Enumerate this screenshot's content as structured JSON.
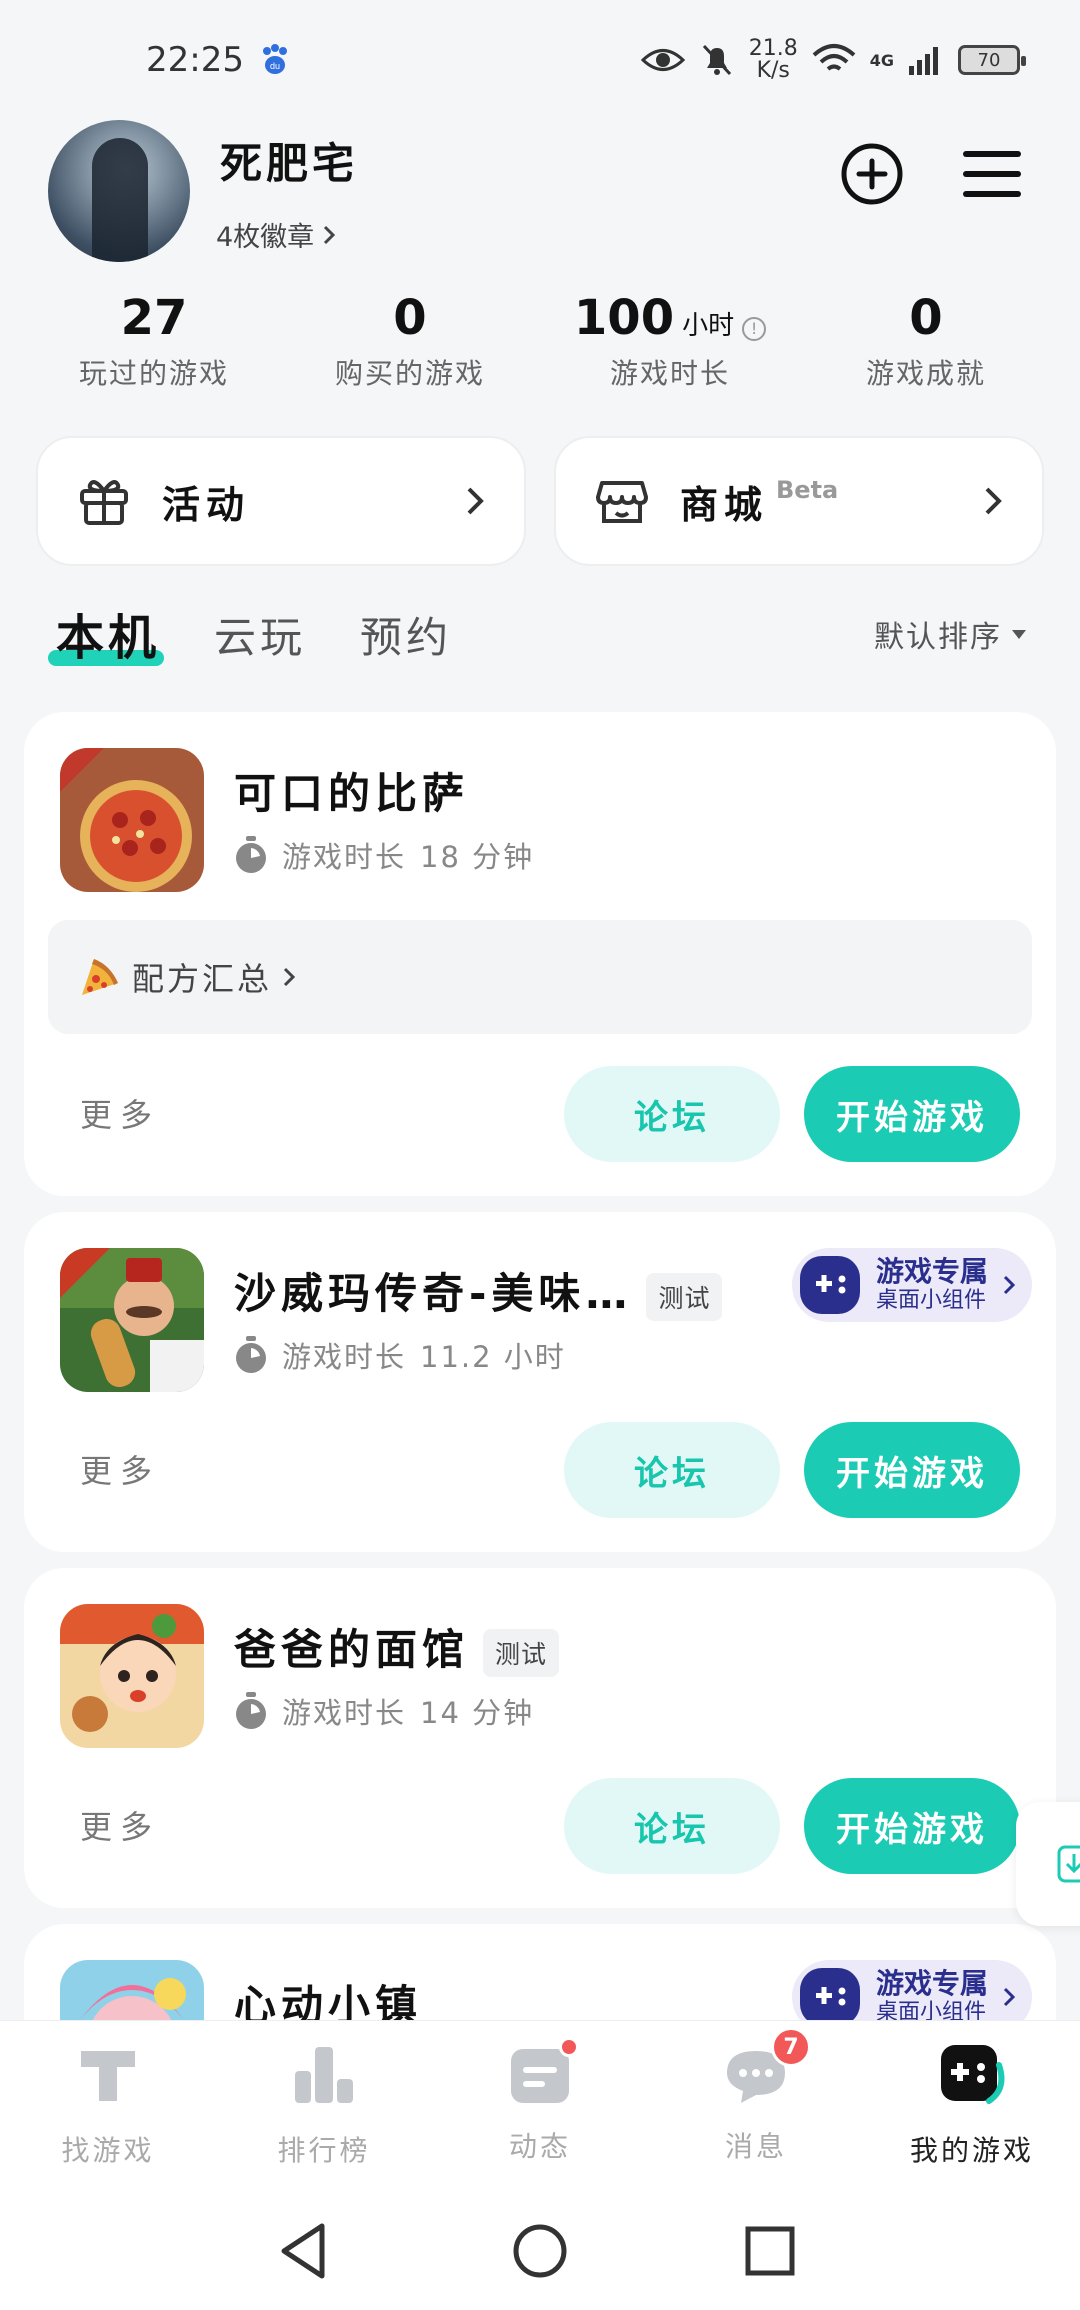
{
  "status_bar": {
    "time": "22:25",
    "net_speed_value": "21.8",
    "net_speed_unit": "K/s",
    "network": "4G",
    "battery": "70"
  },
  "profile": {
    "name": "死肥宅",
    "badges": "4枚徽章"
  },
  "stats": [
    {
      "value": "27",
      "unit": "",
      "label": "玩过的游戏"
    },
    {
      "value": "0",
      "unit": "",
      "label": "购买的游戏"
    },
    {
      "value": "100",
      "unit": "小时",
      "label": "游戏时长"
    },
    {
      "value": "0",
      "unit": "",
      "label": "游戏成就"
    }
  ],
  "quick_links": [
    {
      "label": "活动",
      "tag": ""
    },
    {
      "label": "商城",
      "tag": "Beta"
    }
  ],
  "tabs": [
    {
      "label": "本机",
      "active": true
    },
    {
      "label": "云玩",
      "active": false
    },
    {
      "label": "预约",
      "active": false
    }
  ],
  "sort_label": "默认排序",
  "games": [
    {
      "title": "可口的比萨",
      "tag": "",
      "playtime_label": "游戏时长",
      "playtime": "18 分钟",
      "recipe": "配方汇总",
      "more": "更多",
      "forum": "论坛",
      "play": "开始游戏"
    },
    {
      "title": "沙威玛传奇-美味…",
      "tag": "测试",
      "playtime_label": "游戏时长",
      "playtime": "11.2 小时",
      "widget_title": "游戏专属",
      "widget_sub": "桌面小组件",
      "more": "更多",
      "forum": "论坛",
      "play": "开始游戏"
    },
    {
      "title": "爸爸的面馆",
      "tag": "测试",
      "playtime_label": "游戏时长",
      "playtime": "14 分钟",
      "more": "更多",
      "forum": "论坛",
      "play": "开始游戏"
    },
    {
      "title": "心动小镇",
      "widget_title": "游戏专属",
      "widget_sub": "桌面小组件"
    }
  ],
  "bottom_nav": [
    {
      "label": "找游戏",
      "active": false
    },
    {
      "label": "排行榜",
      "active": false
    },
    {
      "label": "动态",
      "active": false
    },
    {
      "label": "消息",
      "active": false,
      "badge": "7"
    },
    {
      "label": "我的游戏",
      "active": true
    }
  ],
  "colors": {
    "accent": "#1ccbb3",
    "accent_light": "#e2f8f6",
    "badge_red": "#f25858",
    "widget_navy": "#2a2f8e"
  }
}
